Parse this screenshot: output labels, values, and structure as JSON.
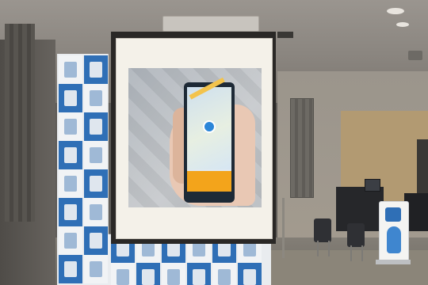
{
  "scene": {
    "description_colors": {
      "backdrop_blue": "#2f6fb6",
      "backdrop_white": "#f1f3f5",
      "screen": "#f4f1e9",
      "app_accent": "#f3a41b"
    }
  }
}
